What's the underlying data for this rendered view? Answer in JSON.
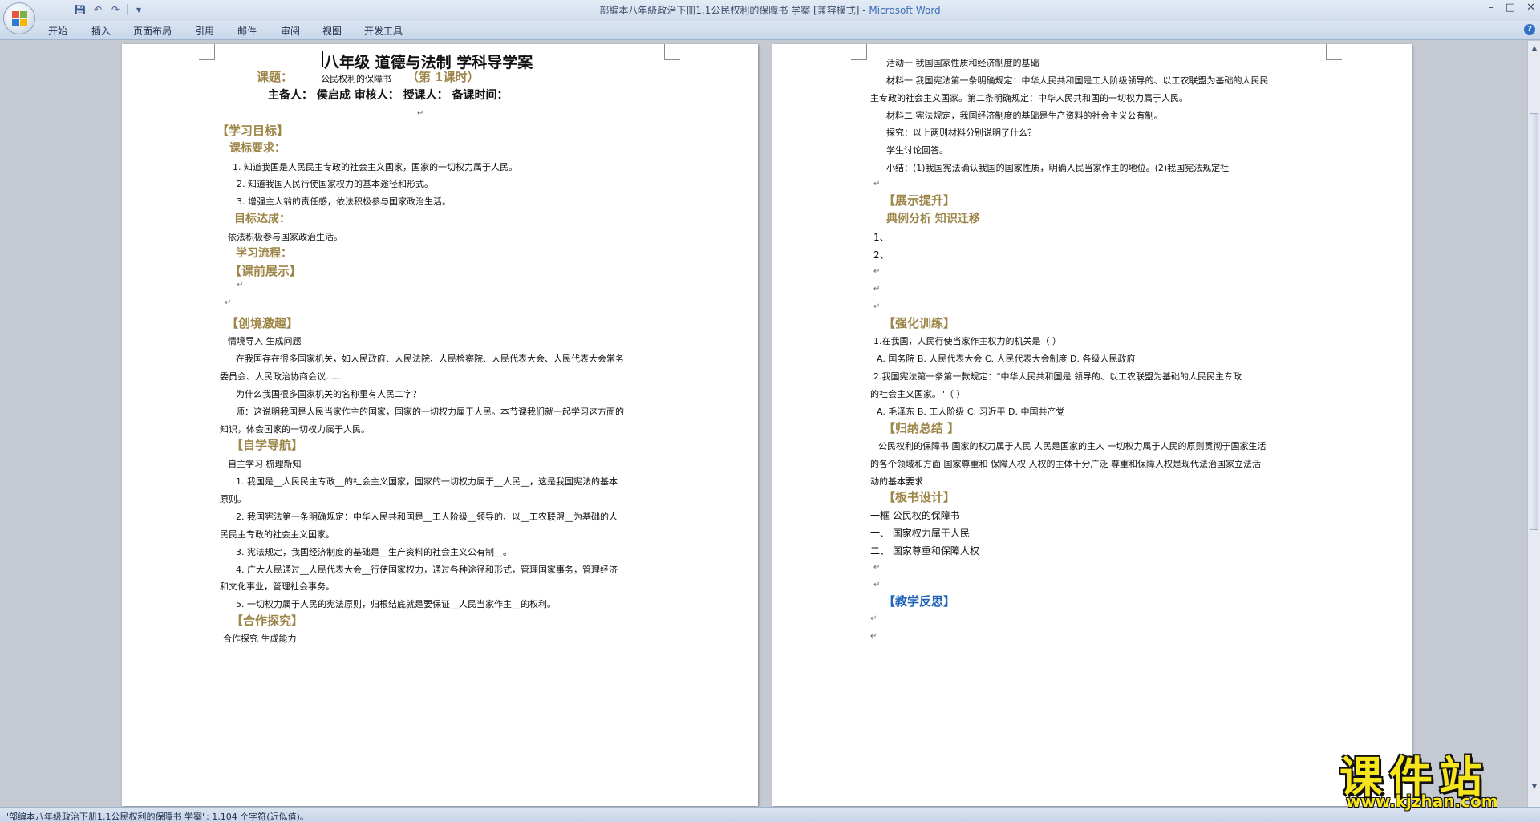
{
  "window": {
    "title": "部編本八年級政治下冊1.1公民权利的保障书 学案 [兼容模式]",
    "app_name": "Microsoft Word",
    "controls": [
      "–",
      "□",
      "✕"
    ]
  },
  "ribbon": {
    "tabs": [
      "开始",
      "插入",
      "页面布局",
      "引用",
      "邮件",
      "审阅",
      "视图",
      "开发工具"
    ]
  },
  "left_page": {
    "title": "八年级 道德与法制     学科导学案",
    "topic_label": "课题：",
    "topic_text": "公民权利的保障书",
    "session": "（第  1课时）",
    "preparers": "主备人：  侯启成   审核人：      授课人：     备课时间：",
    "lines": [
      "【学习目标】",
      "课标要求：",
      "1. 知道我国是人民民主专政的社会主义国家，国家的一切权力属于人民。",
      "2. 知道我国人民行使国家权力的基本途径和形式。",
      "3. 增强主人翁的责任感，依法积极参与国家政治生活。",
      "目标达成：",
      "依法积极参与国家政治生活。",
      "学习流程：",
      "【课前展示】",
      "【创境激趣】",
      "情境导入   生成问题",
      "在我国存在很多国家机关，如人民政府、人民法院、人民检察院、人民代表大会、人民代表大会常务",
      "委员会、人民政治协商会议……",
      "为什么我国很多国家机关的名称里有人民二字？",
      "师：这说明我国是人民当家作主的国家，国家的一切权力属于人民。本节课我们就一起学习这方面的",
      "知识，体会国家的一切权力属于人民。",
      "【自学导航】",
      "自主学习   梳理新知",
      "1. 我国是__人民民主专政__的社会主义国家，国家的一切权力属于__人民__，这是我国宪法的基本",
      "原则。",
      "2. 我国宪法第一条明确规定：中华人民共和国是__工人阶级__领导的、以__工农联盟__为基础的人",
      "民民主专政的社会主义国家。",
      "3. 宪法规定，我国经济制度的基础是__生产资料的社会主义公有制__。",
      "4. 广大人民通过__人民代表大会__行使国家权力，通过各种途径和形式，管理国家事务，管理经济",
      "和文化事业，管理社会事务。",
      "5. 一切权力属于人民的宪法原则，归根结底就是要保证__人民当家作主__的权利。",
      "【合作探究】",
      "合作探究   生成能力"
    ]
  },
  "right_page": {
    "lines": [
      "活动一   我国国家性质和经济制度的基础",
      "材料一   我国宪法第一条明确规定：中华人民共和国是工人阶级领导的、以工农联盟为基础的人民民",
      "主专政的社会主义国家。第二条明确规定：中华人民共和国的一切权力属于人民。",
      "材料二   宪法规定，我国经济制度的基础是生产资料的社会主义公有制。",
      "探究：以上两则材料分别说明了什么？",
      "学生讨论回答。",
      "小结：(1)我国宪法确认我国的国家性质，明确人民当家作主的地位。(2)我国宪法规定社",
      "【展示提升】",
      "典例分析 知识迁移",
      "1、",
      "2、",
      "【强化训练】",
      "1.在我国，人民行使当家作主权力的机关是（      ）",
      "A. 国务院  B. 人民代表大会  C. 人民代表大会制度  D. 各级人民政府",
      "2.我国宪法第一条第一款规定：\"中华人民共和国是            领导的、以工农联盟为基础的人民民主专政",
      "的社会主义国家。\"（  ）",
      "A. 毛泽东  B. 工人阶级  C. 习近平  D. 中国共产党",
      "【归纳总结 】",
      "公民权利的保障书 国家的权力属于人民  人民是国家的主人  一切权力属于人民的原则贯彻于国家生活",
      "的各个领域和方面 国家尊重和  保障人权  人权的主体十分广泛  尊重和保障人权是现代法治国家立法活",
      "动的基本要求",
      "【板书设计】",
      "一框    公民权的保障书",
      "一、     国家权力属于人民",
      "二、     国家尊重和保障人权",
      "【教学反思】"
    ]
  },
  "marks": {
    "para": "↵",
    "down": "↓"
  },
  "status": "\"部编本八年级政治下册1.1公民权利的保障书 学案\": 1,104 个字符(近似值)。",
  "watermark": {
    "big": "课件站",
    "url": "www.kjzhan.com"
  },
  "colors": {
    "heading_gold": "#9c8547",
    "heading_blue": "#1f63b8",
    "watermark_yellow": "#f6e41c"
  }
}
